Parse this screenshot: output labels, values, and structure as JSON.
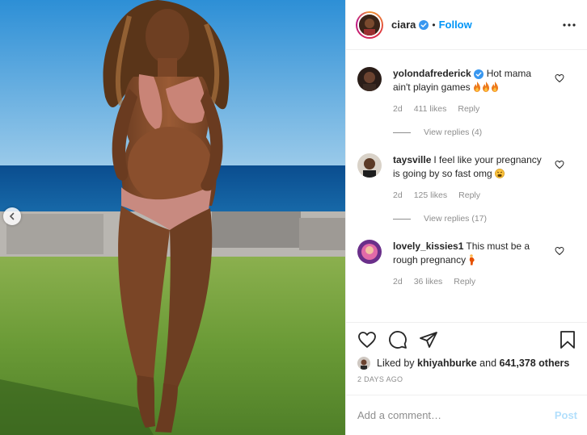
{
  "post": {
    "image_description_icon": "photo",
    "carousel_prev_icon": "chevron-left-icon"
  },
  "header": {
    "username": "ciara",
    "separator": "•",
    "follow_label": "Follow",
    "verified_color": "#3897f0",
    "more_icon": "ellipsis-icon"
  },
  "comments": [
    {
      "username": "yolondafrederick",
      "verified": true,
      "text": "Hot mama ain't playin games",
      "emoji": "fire x3",
      "age": "2d",
      "likes": "411 likes",
      "reply_label": "Reply",
      "view_replies": "View replies (4)"
    },
    {
      "username": "taysville",
      "verified": false,
      "text": "I feel like your pregnancy is going by so fast omg",
      "emoji": "tired-face",
      "age": "2d",
      "likes": "125 likes",
      "reply_label": "Reply",
      "view_replies": "View replies (17)"
    },
    {
      "username": "lovely_kissies1",
      "verified": false,
      "text": "This must be a rough pregnancy",
      "emoji": "pregnant-woman",
      "age": "2d",
      "likes": "36 likes",
      "reply_label": "Reply"
    }
  ],
  "actions": {
    "like_icon": "heart-icon",
    "comment_icon": "comment-icon",
    "share_icon": "share-icon",
    "save_icon": "bookmark-icon"
  },
  "likes_summary": {
    "prefix": "Liked by",
    "user": "khiyahburke",
    "conjunction": "and",
    "others": "641,378 others"
  },
  "timestamp": "2 DAYS AGO",
  "add_comment": {
    "placeholder": "Add a comment…",
    "post_label": "Post",
    "post_color_disabled": "#b2dffc"
  },
  "colors": {
    "link_blue": "#0095f6",
    "meta_gray": "#8e8e8e",
    "text": "#262626",
    "flame": "#ed7a1d"
  }
}
